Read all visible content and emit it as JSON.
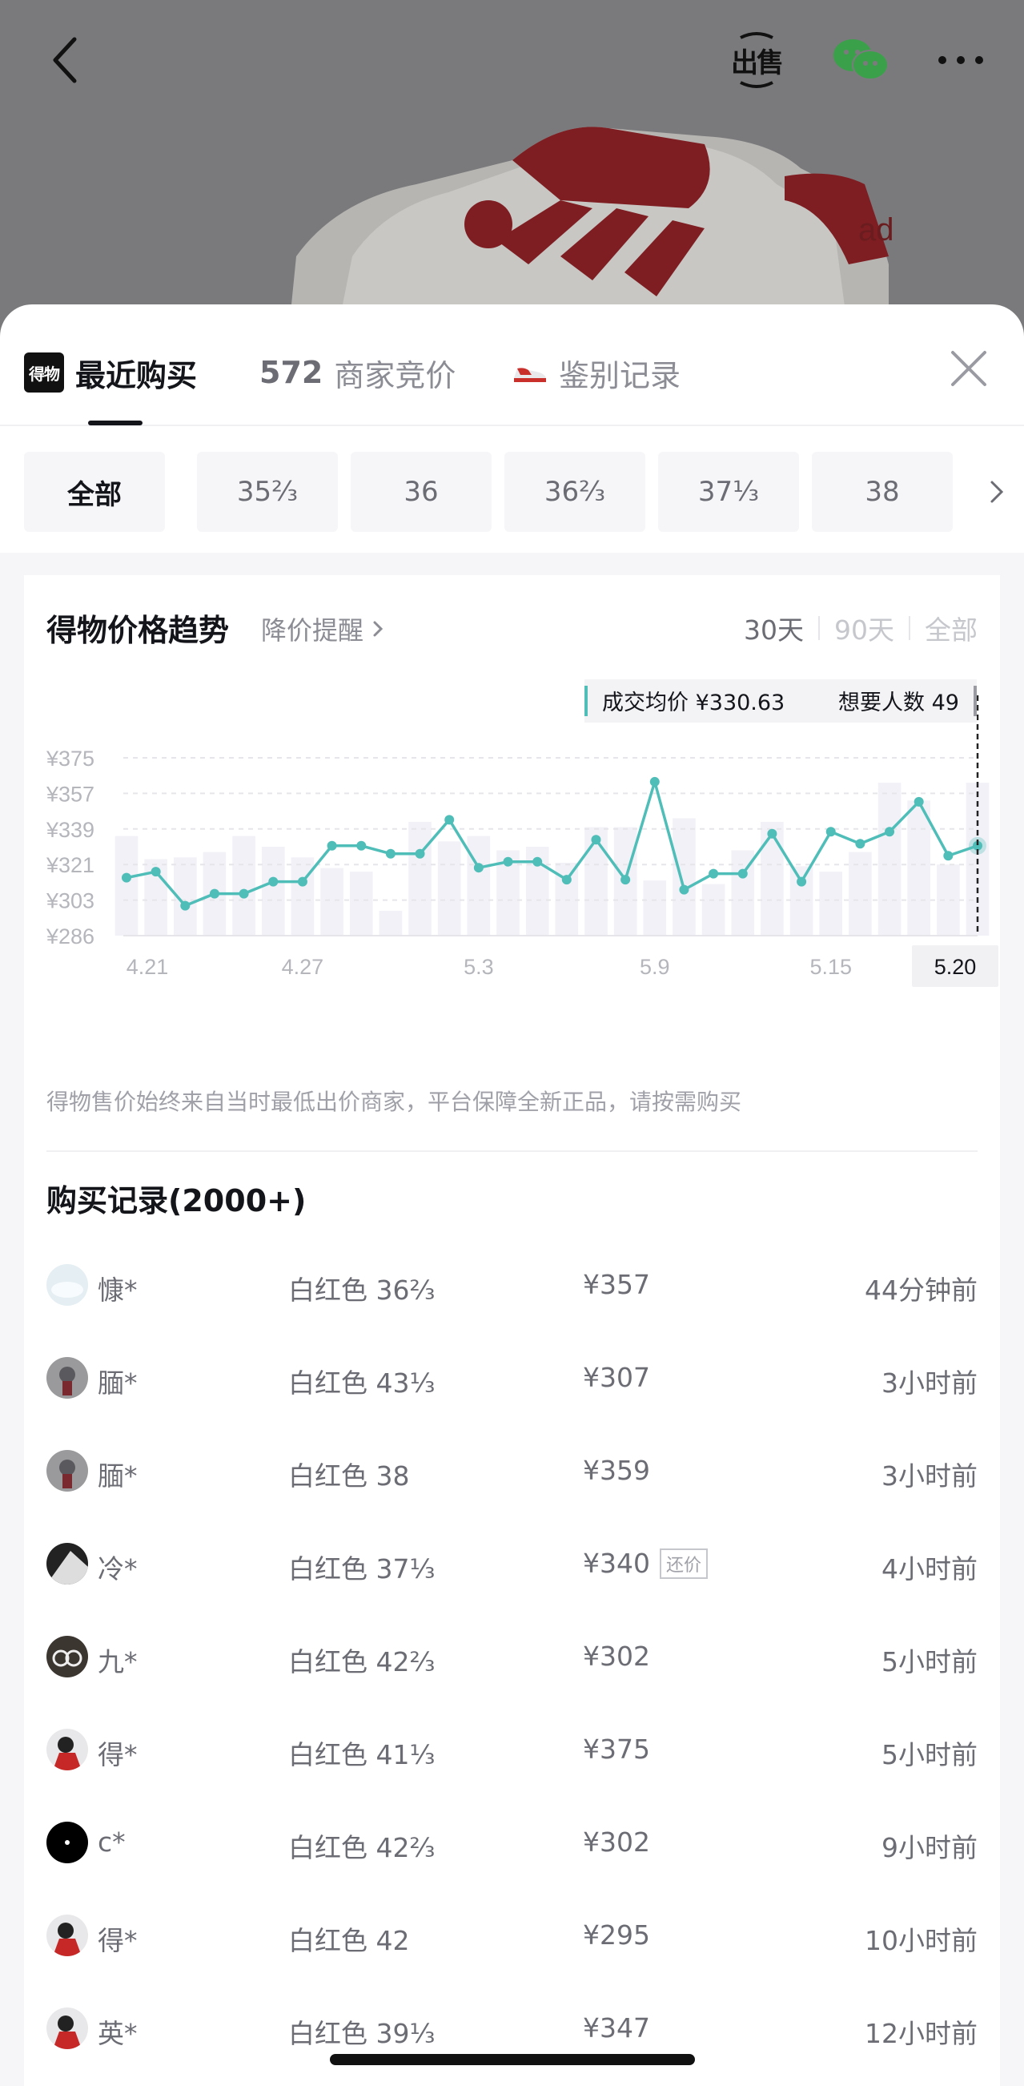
{
  "header": {
    "sell_label": "出售"
  },
  "tabs": [
    {
      "label": "最近购买",
      "logo": "得物"
    },
    {
      "count": "572",
      "label": "商家竞价"
    },
    {
      "label": "鉴别记录"
    }
  ],
  "sizes": [
    "全部",
    "35⅔",
    "36",
    "36⅔",
    "37⅓",
    "38"
  ],
  "trend": {
    "title": "得物价格趋势",
    "alert": "降价提醒",
    "ranges": [
      "30天",
      "90天",
      "全部"
    ],
    "tooltip_avg": "成交均价 ¥330.63",
    "tooltip_want": "想要人数 49",
    "note": "得物售价始终来自当时最低出价商家，平台保障全新正品，请按需购买"
  },
  "chart_data": {
    "type": "line",
    "y_tick_labels": [
      "¥375",
      "¥357",
      "¥339",
      "¥321",
      "¥303",
      "¥286"
    ],
    "ylim": [
      286,
      375
    ],
    "x_tick_labels": [
      "4.21",
      "4.27",
      "5.3",
      "5.9",
      "5.15",
      "5.20"
    ],
    "x": [
      "4.21",
      "4.22",
      "4.23",
      "4.24",
      "4.25",
      "4.26",
      "4.27",
      "4.28",
      "4.29",
      "4.30",
      "5.1",
      "5.2",
      "5.3",
      "5.4",
      "5.5",
      "5.6",
      "5.7",
      "5.8",
      "5.9",
      "5.10",
      "5.11",
      "5.12",
      "5.13",
      "5.14",
      "5.15",
      "5.16",
      "5.17",
      "5.18",
      "5.19",
      "5.20"
    ],
    "series": [
      {
        "values": [
          315,
          318,
          301,
          307,
          307,
          313,
          313,
          331,
          331,
          327,
          327,
          344,
          320,
          323,
          323,
          314,
          334,
          314,
          363,
          309,
          317,
          317,
          337,
          313,
          338,
          332,
          338,
          353,
          326,
          331
        ]
      }
    ],
    "volume_relative": [
      0.56,
      0.43,
      0.44,
      0.47,
      0.56,
      0.5,
      0.44,
      0.38,
      0.36,
      0.14,
      0.64,
      0.53,
      0.56,
      0.48,
      0.5,
      0.41,
      0.61,
      0.61,
      0.31,
      0.66,
      0.29,
      0.48,
      0.64,
      0.39,
      0.36,
      0.47,
      0.86,
      0.76,
      0.4,
      0.86
    ],
    "selected_x": "5.20",
    "grid": true
  },
  "records": {
    "title": "购买记录(2000+)",
    "rows": [
      {
        "name": "慷*",
        "size": "白红色 36⅔",
        "price": "¥357",
        "badge": "",
        "time": "44分钟前",
        "avatar": "light"
      },
      {
        "name": "腼*",
        "size": "白红色 43⅓",
        "price": "¥307",
        "badge": "",
        "time": "3小时前",
        "avatar": "grey"
      },
      {
        "name": "腼*",
        "size": "白红色 38",
        "price": "¥359",
        "badge": "",
        "time": "3小时前",
        "avatar": "grey"
      },
      {
        "name": "冷*",
        "size": "白红色 37⅓",
        "price": "¥340",
        "badge": "还价",
        "time": "4小时前",
        "avatar": "bw"
      },
      {
        "name": "九*",
        "size": "白红色 42⅔",
        "price": "¥302",
        "badge": "",
        "time": "5小时前",
        "avatar": "glasses"
      },
      {
        "name": "得*",
        "size": "白红色 41⅓",
        "price": "¥375",
        "badge": "",
        "time": "5小时前",
        "avatar": "hero"
      },
      {
        "name": "c*",
        "size": "白红色 42⅔",
        "price": "¥302",
        "badge": "",
        "time": "9小时前",
        "avatar": "black"
      },
      {
        "name": "得*",
        "size": "白红色 42",
        "price": "¥295",
        "badge": "",
        "time": "10小时前",
        "avatar": "hero"
      },
      {
        "name": "英*",
        "size": "白红色 39⅓",
        "price": "¥347",
        "badge": "",
        "time": "12小时前",
        "avatar": "hero"
      }
    ]
  },
  "colors": {
    "accent": "#4fbdb8",
    "bar": "#f1f1f7",
    "text_primary": "#14151a",
    "text_secondary": "#6b6c74"
  }
}
